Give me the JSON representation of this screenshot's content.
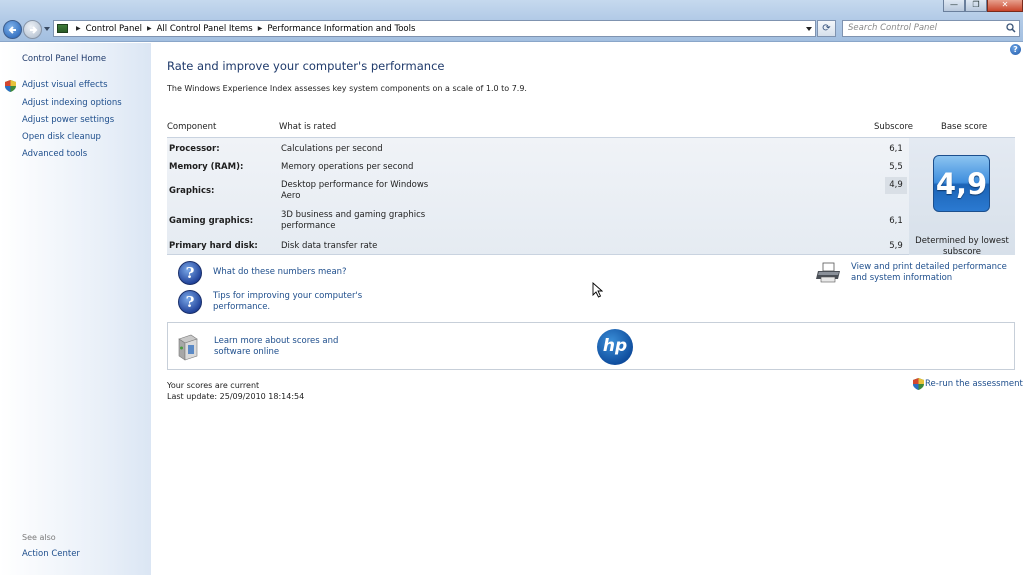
{
  "window": {
    "minimize_glyph": "—",
    "maximize_glyph": "❐",
    "close_glyph": "✕"
  },
  "address": {
    "crumbs": [
      "Control Panel",
      "All Control Panel Items",
      "Performance Information and Tools"
    ],
    "search_placeholder": "Search Control Panel"
  },
  "sidebar": {
    "home": "Control Panel Home",
    "items": [
      {
        "label": "Adjust visual effects",
        "icon": "shield-icon"
      },
      {
        "label": "Adjust indexing options"
      },
      {
        "label": "Adjust power settings"
      },
      {
        "label": "Open disk cleanup"
      },
      {
        "label": "Advanced tools"
      }
    ],
    "see_also": "See also",
    "action_center": "Action Center"
  },
  "main": {
    "title": "Rate and improve your computer's performance",
    "intro": "The Windows Experience Index assesses key system components on a scale of 1.0 to 7.9.",
    "headers": {
      "component": "Component",
      "what": "What is rated",
      "subscore": "Subscore",
      "base": "Base score"
    },
    "rows": [
      {
        "component": "Processor:",
        "what": "Calculations per second",
        "subscore": "6,1"
      },
      {
        "component": "Memory (RAM):",
        "what": "Memory operations per second",
        "subscore": "5,5"
      },
      {
        "component": "Graphics:",
        "what": "Desktop performance for Windows Aero",
        "subscore": "4,9"
      },
      {
        "component": "Gaming graphics:",
        "what": "3D business and gaming graphics performance",
        "subscore": "6,1"
      },
      {
        "component": "Primary hard disk:",
        "what": "Disk data transfer rate",
        "subscore": "5,9"
      }
    ],
    "base_score": "4,9",
    "base_caption": "Determined by lowest subscore",
    "links": {
      "numbers": "What do these numbers mean?",
      "tips": "Tips for improving your computer's performance.",
      "print": "View and print detailed performance and system information",
      "learn": "Learn more about scores and software online"
    },
    "hp_logo": "hp",
    "status": {
      "current": "Your scores are current",
      "last_update": "Last update: 25/09/2010 18:14:54"
    },
    "rerun": "Re-run the assessment"
  },
  "colors": {
    "link": "#1e4e8c",
    "title": "#1f3a6b",
    "score_tile": "#2b7ad1"
  }
}
